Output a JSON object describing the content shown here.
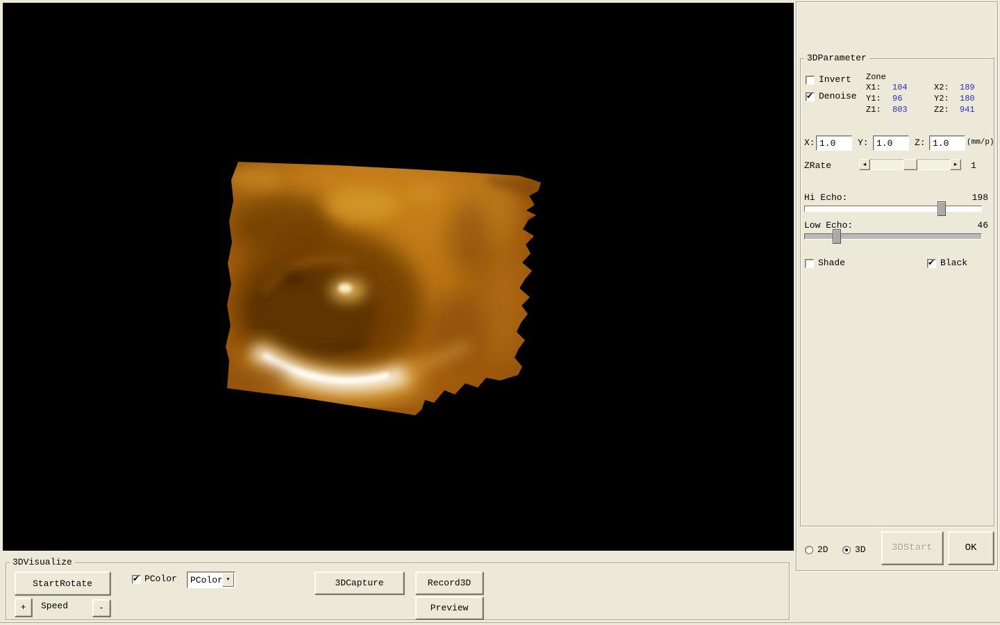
{
  "icons": {
    "dropdown_arrow": "▼",
    "scroll_left": "◄",
    "scroll_right": "►",
    "check": "✔"
  },
  "colors": {
    "face": "#ece9d8",
    "value_blue": "#2b2bc8",
    "viewport_bg": "#000000"
  },
  "right_panel": {
    "group_title": "3DParameter",
    "invert": {
      "label": "Invert",
      "checked": false
    },
    "denoise": {
      "label": "Denoise",
      "checked": true
    },
    "zone": {
      "title": "Zone",
      "r1": {
        "a": "X1:",
        "av": "104",
        "b": "X2:",
        "bv": "189"
      },
      "r2": {
        "a": "Y1:",
        "av": "96",
        "b": "Y2:",
        "bv": "180"
      },
      "r3": {
        "a": "Z1:",
        "av": "803",
        "b": "Z2:",
        "bv": "941"
      }
    },
    "scale": {
      "x_label": "X:",
      "x_value": "1.0",
      "y_label": "Y:",
      "y_value": "1.0",
      "z_label": "Z:",
      "z_value": "1.0",
      "unit": "(mm/p)"
    },
    "zrate": {
      "label": "ZRate",
      "value": "1"
    },
    "hi_echo": {
      "label": "Hi Echo:",
      "value": 198,
      "max": 255
    },
    "low_echo": {
      "label": "Low Echo:",
      "value": 46,
      "max": 255
    },
    "shade": {
      "label": "Shade",
      "checked": false
    },
    "black": {
      "label": "Black",
      "checked": true
    },
    "mode": "3D",
    "radio_2d": "2D",
    "radio_3d": "3D",
    "start3d_label": "3DStart",
    "ok_label": "OK"
  },
  "visualize_panel": {
    "group_title": "3DVisualize",
    "start_rotate_label": "StartRotate",
    "pcolor": {
      "label": "PColor",
      "checked": true
    },
    "pcolor_combo_value": "PColor",
    "capture_label": "3DCapture",
    "record_label": "Record3D",
    "preview_label": "Preview",
    "plus_label": "+",
    "speed_label": "Speed",
    "minus_label": "-"
  }
}
